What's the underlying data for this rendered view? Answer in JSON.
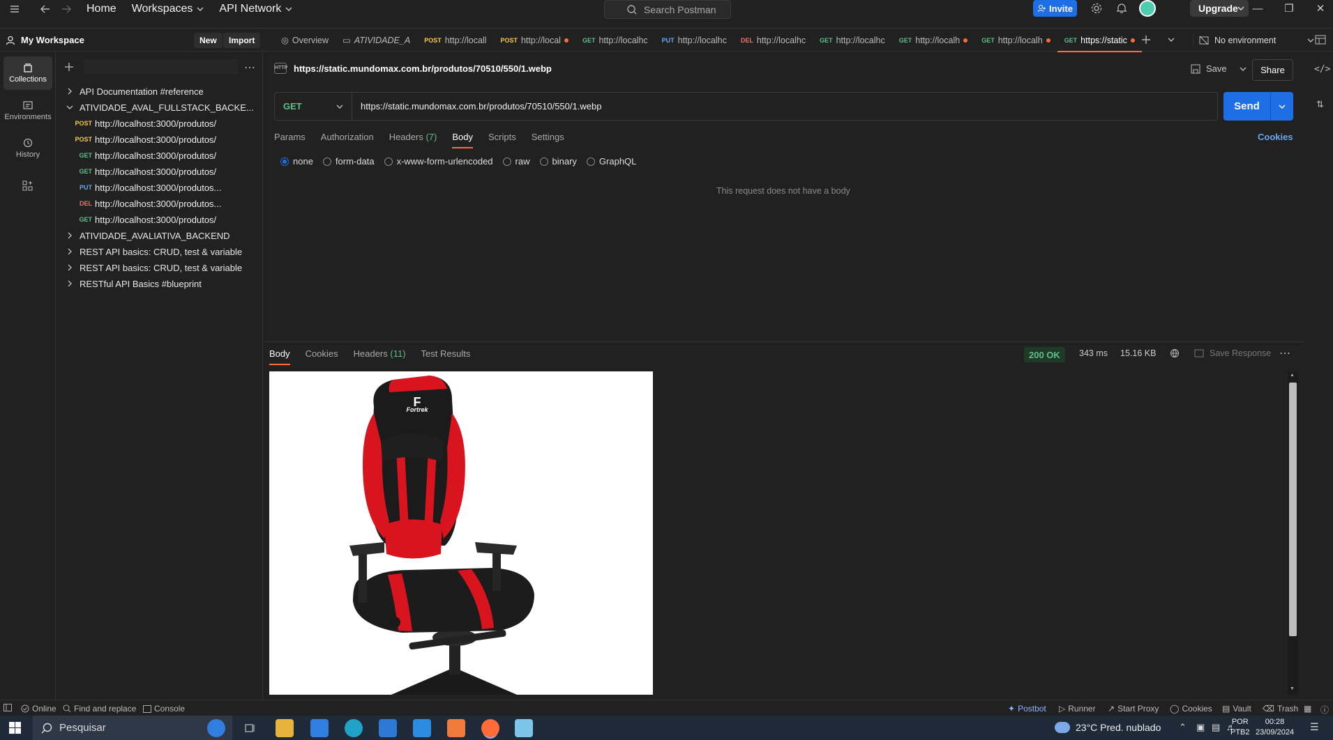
{
  "topbar": {
    "home": "Home",
    "workspaces": "Workspaces",
    "api_network": "API Network",
    "search_placeholder": "Search Postman",
    "invite": "Invite",
    "upgrade": "Upgrade"
  },
  "workspace": {
    "title": "My Workspace",
    "new_label": "New",
    "import_label": "Import"
  },
  "tabs": [
    {
      "method": "",
      "label": "Overview",
      "dot": false
    },
    {
      "method": "",
      "label": "ATIVIDADE_A",
      "dot": false
    },
    {
      "method": "POST",
      "label": "http://locall",
      "dot": false
    },
    {
      "method": "POST",
      "label": "http://local",
      "dot": true
    },
    {
      "method": "GET",
      "label": "http://localhc",
      "dot": false
    },
    {
      "method": "PUT",
      "label": "http://localhc",
      "dot": false
    },
    {
      "method": "DEL",
      "label": "http://localhc",
      "dot": false
    },
    {
      "method": "GET",
      "label": "http://localhc",
      "dot": false
    },
    {
      "method": "GET",
      "label": "http://localh",
      "dot": true
    },
    {
      "method": "GET",
      "label": "http://localh",
      "dot": true
    },
    {
      "method": "GET",
      "label": "https://static",
      "dot": true
    }
  ],
  "environment": "No environment",
  "rail": {
    "collections": "Collections",
    "environments": "Environments",
    "history": "History"
  },
  "sidebar": {
    "collections": [
      {
        "name": "API Documentation #reference",
        "expanded": false
      },
      {
        "name": "ATIVIDADE_AVAL_FULLSTACK_BACKE...",
        "expanded": true
      },
      {
        "name": "ATIVIDADE_AVALIATIVA_BACKEND",
        "expanded": false
      },
      {
        "name": "REST API basics: CRUD, test & variable",
        "expanded": false
      },
      {
        "name": "REST API basics: CRUD, test & variable",
        "expanded": false
      },
      {
        "name": "RESTful API Basics #blueprint",
        "expanded": false
      }
    ],
    "requests": [
      {
        "method": "POST",
        "url": "http://localhost:3000/produtos/"
      },
      {
        "method": "POST",
        "url": "http://localhost:3000/produtos/"
      },
      {
        "method": "GET",
        "url": "http://localhost:3000/produtos/"
      },
      {
        "method": "GET",
        "url": "http://localhost:3000/produtos/"
      },
      {
        "method": "PUT",
        "url": "http://localhost:3000/produtos..."
      },
      {
        "method": "DEL",
        "url": "http://localhost:3000/produtos..."
      },
      {
        "method": "GET",
        "url": "http://localhost:3000/produtos/"
      }
    ]
  },
  "request": {
    "title": "https://static.mundomax.com.br/produtos/70510/550/1.webp",
    "save": "Save",
    "share": "Share",
    "method": "GET",
    "url": "https://static.mundomax.com.br/produtos/70510/550/1.webp",
    "send": "Send",
    "tabs": {
      "params": "Params",
      "authorization": "Authorization",
      "headers": "Headers",
      "headers_count": "(7)",
      "body": "Body",
      "scripts": "Scripts",
      "settings": "Settings"
    },
    "cookies": "Cookies",
    "body_types": [
      "none",
      "form-data",
      "x-www-form-urlencoded",
      "raw",
      "binary",
      "GraphQL"
    ],
    "selected_body_type": "none",
    "no_body_text": "This request does not have a body"
  },
  "response": {
    "tabs": {
      "body": "Body",
      "cookies": "Cookies",
      "headers": "Headers",
      "headers_count": "(11)",
      "test_results": "Test Results"
    },
    "status": "200 OK",
    "time": "343 ms",
    "size": "15.16 KB",
    "save_response": "Save Response",
    "image_text": "Fortrek"
  },
  "statusbar": {
    "online": "Online",
    "find_replace": "Find and replace",
    "console": "Console",
    "postbot": "Postbot",
    "runner": "Runner",
    "start_proxy": "Start Proxy",
    "cookies": "Cookies",
    "vault": "Vault",
    "trash": "Trash"
  },
  "taskbar": {
    "search": "Pesquisar",
    "weather": "23°C  Pred. nublado",
    "lang1": "POR",
    "lang2": "PTB2",
    "time": "00:28",
    "date": "23/09/2024"
  },
  "colors": {
    "accent": "#ff6c37",
    "primary": "#1e6ee6",
    "get": "#5fbf8a",
    "post": "#f2c94c",
    "put": "#6aa8f0",
    "del": "#e8776b"
  }
}
